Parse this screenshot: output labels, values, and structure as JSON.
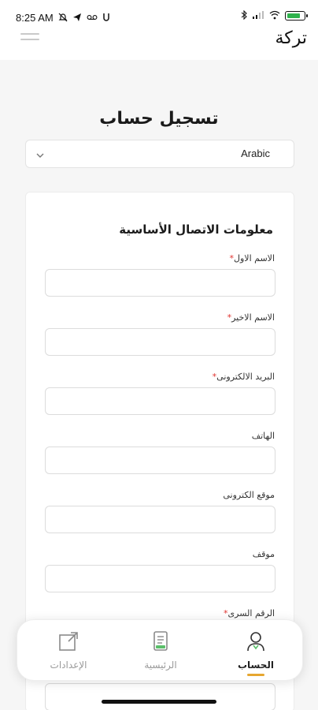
{
  "status_bar": {
    "time": "8:25 AM",
    "left_icons": [
      "muted-bell-icon",
      "telegram-icon",
      "voicemail-icon",
      "u-icon"
    ],
    "right_icons": [
      "bluetooth-icon",
      "signal-icon",
      "wifi-icon",
      "battery-icon"
    ],
    "battery_level": 0.85,
    "battery_color": "#2fb24c"
  },
  "header": {
    "title": "تركة",
    "menu_icon": "hamburger-menu-icon"
  },
  "page": {
    "title": "تسجيل حساب",
    "language_select": {
      "value": "Arabic",
      "icon": "chevron-down-icon"
    }
  },
  "form": {
    "section_title": "معلومات الاتصال الأساسية",
    "required_marker": "*",
    "required_color": "#e0332f",
    "fields": [
      {
        "label": "الاسم الاول",
        "required": true,
        "value": ""
      },
      {
        "label": "الاسم الاخير",
        "required": true,
        "value": ""
      },
      {
        "label": "البريد الالكترونى",
        "required": true,
        "value": ""
      },
      {
        "label": "الهاتف",
        "required": false,
        "value": ""
      },
      {
        "label": "موقع الكترونى",
        "required": false,
        "value": ""
      },
      {
        "label": "موقف",
        "required": false,
        "value": ""
      },
      {
        "label": "الرقم السرى",
        "required": true,
        "value": ""
      }
    ]
  },
  "bottom_nav": {
    "accent": "#e6a630",
    "items": [
      {
        "label": "الإعدادات",
        "icon": "external-link-icon",
        "active": false
      },
      {
        "label": "الرئيسية",
        "icon": "document-icon",
        "active": false
      },
      {
        "label": "الحساب",
        "icon": "user-icon",
        "active": true
      }
    ]
  }
}
